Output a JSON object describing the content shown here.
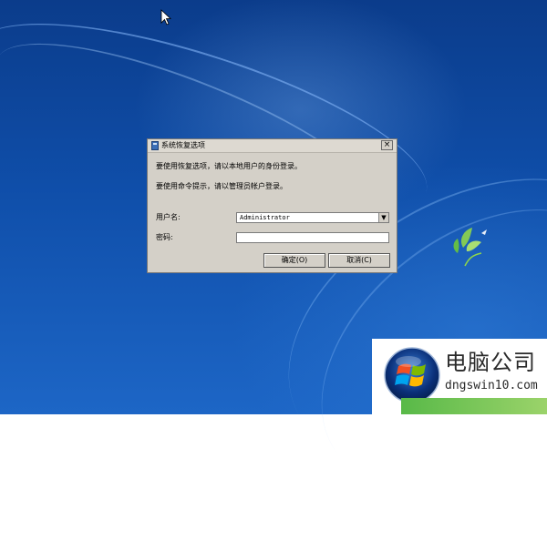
{
  "dialog": {
    "title": "系统恢复选项",
    "message1": "要使用恢复选项，请以本地用户的身份登录。",
    "message2": "要使用命令提示，请以管理员帐户登录。",
    "username_label": "用户名:",
    "username_value": "Administrator",
    "password_label": "密码:",
    "password_value": "",
    "ok_label": "确定(O)",
    "cancel_label": "取消(C)",
    "close_glyph": "×",
    "dropdown_glyph": "▼"
  },
  "watermark": {
    "title": "电脑公司",
    "url": "dngswin10.com"
  },
  "icons": {
    "cursor": "mouse-pointer",
    "title_icon": "recovery-icon",
    "logo": "windows-logo",
    "leaf": "windows7-leaf"
  },
  "colors": {
    "desktop": "#0f4ea9",
    "dialog_bg": "#d4d0c8",
    "watermark_accent": "#58b948"
  }
}
